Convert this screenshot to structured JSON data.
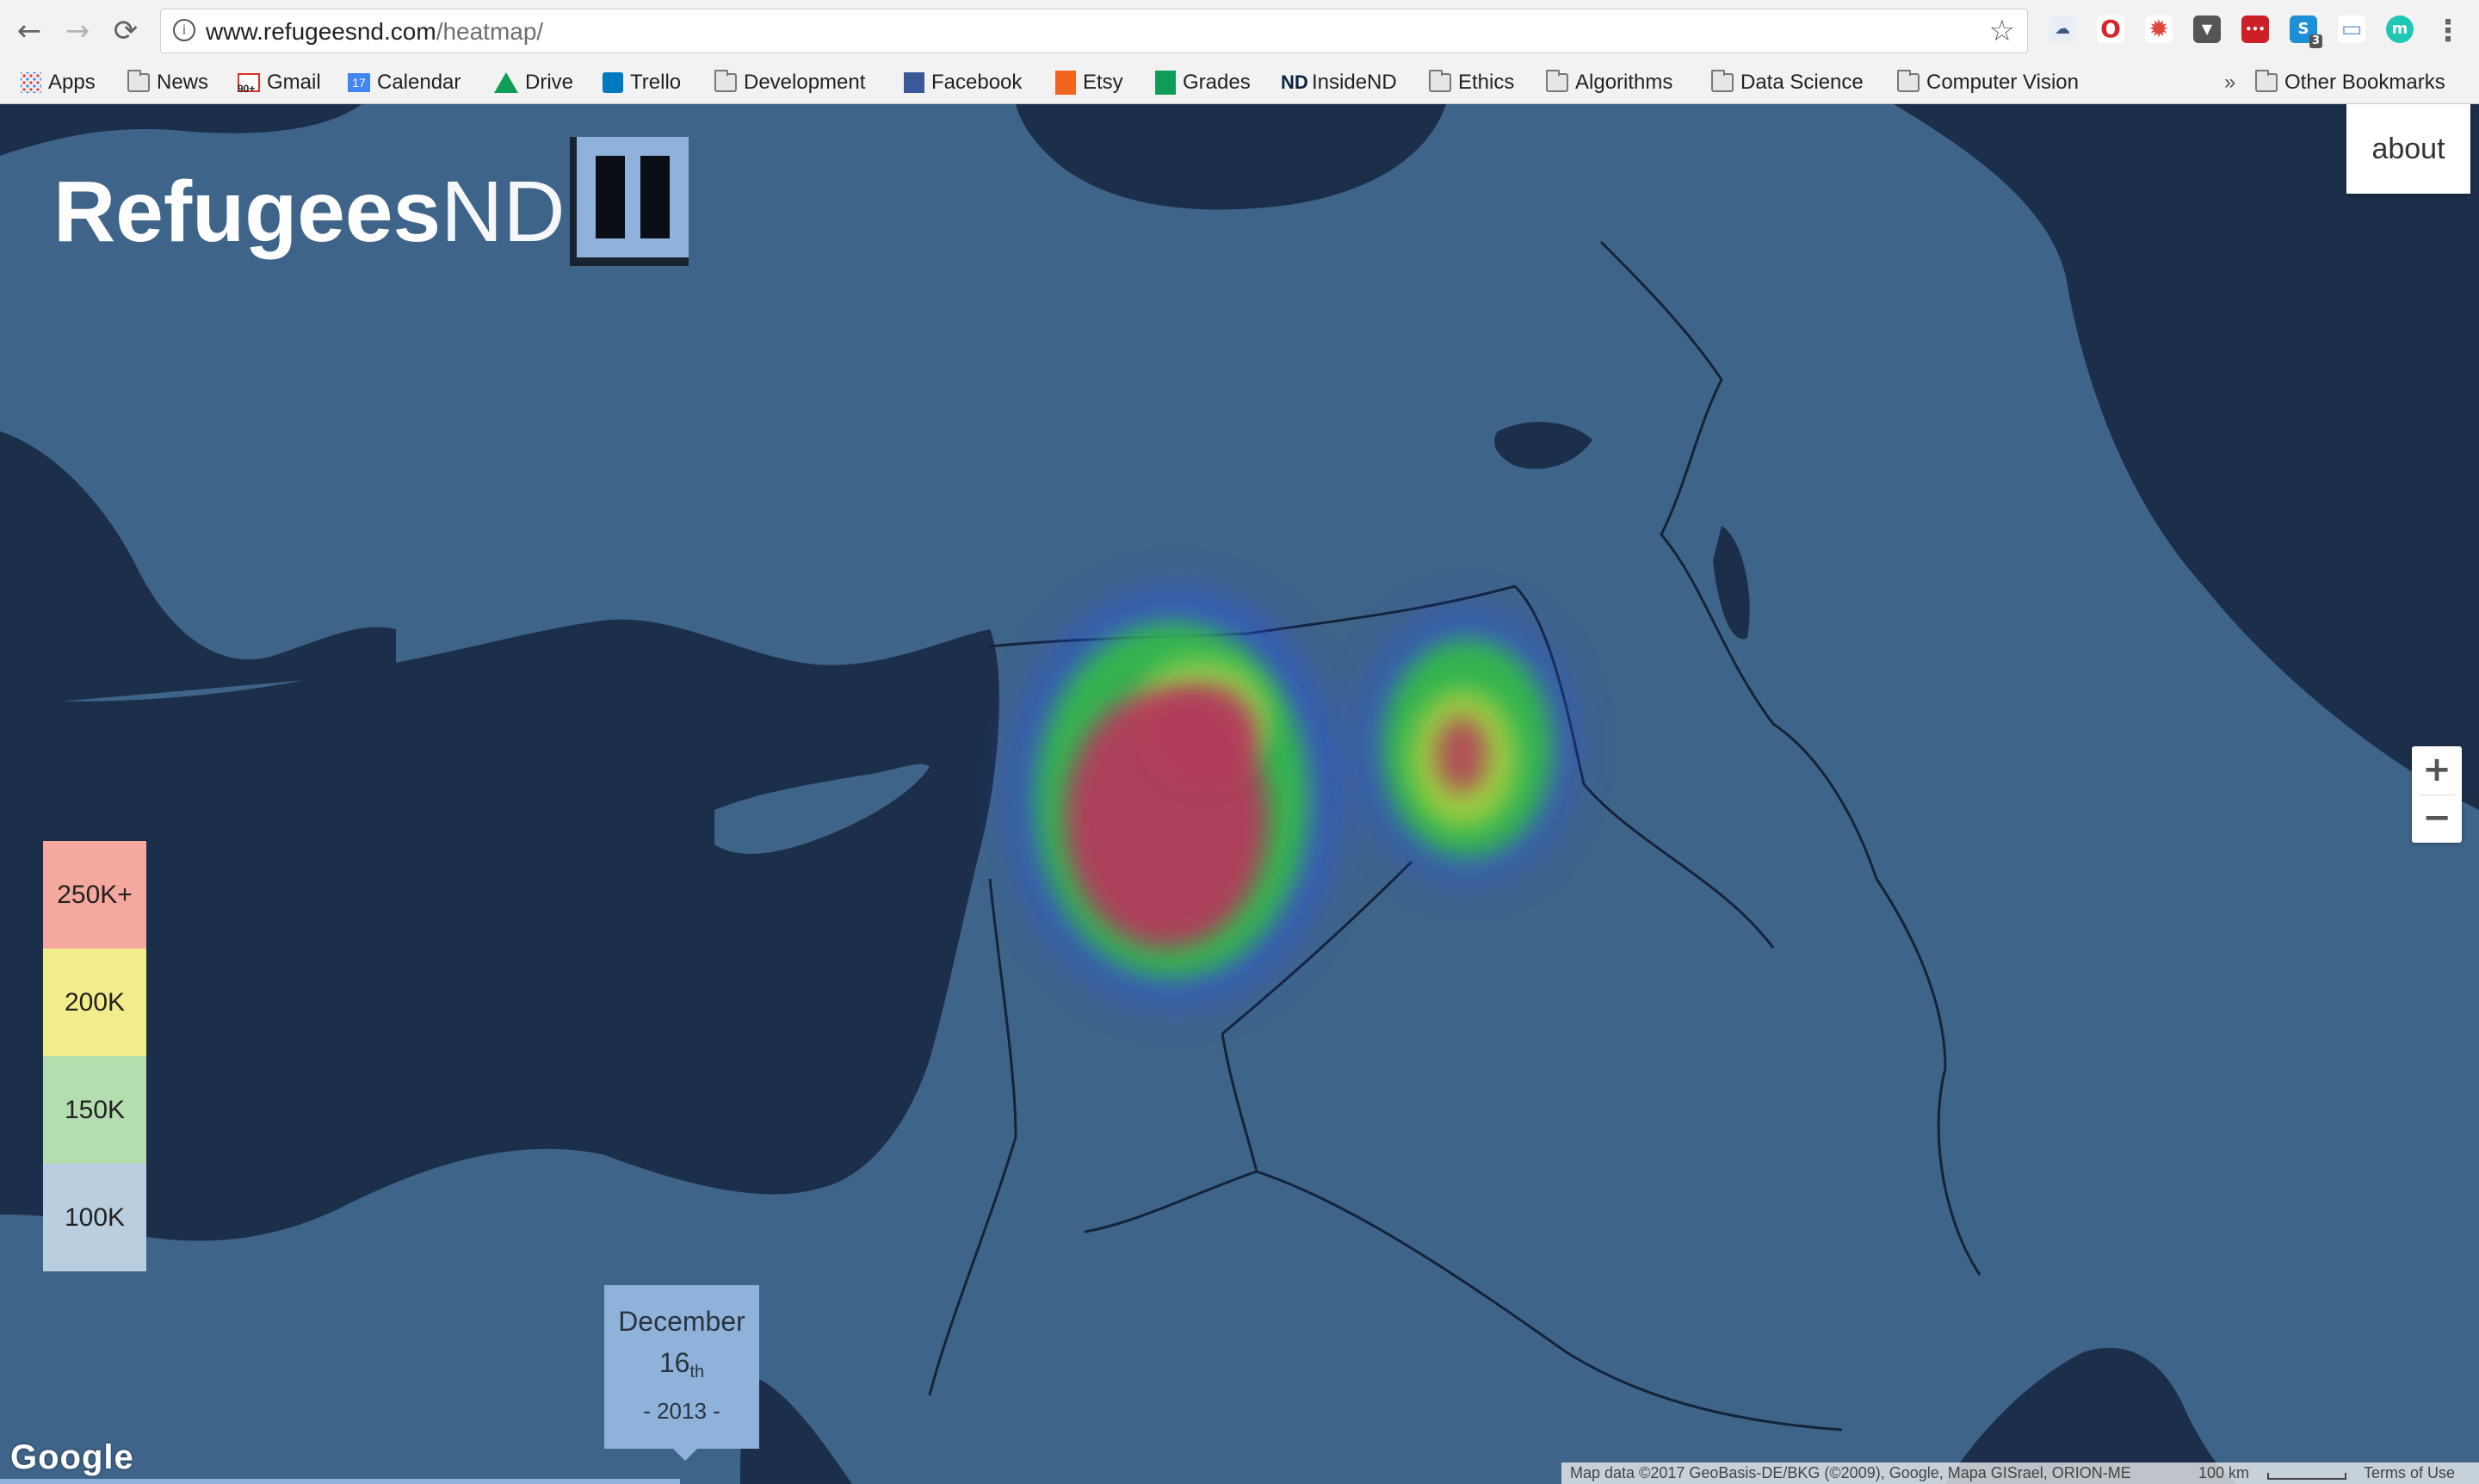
{
  "browser": {
    "url_host": "www.refugeesnd.com",
    "url_path": "/heatmap/",
    "nav": {
      "back": "←",
      "forward": "→",
      "reload": "⟳"
    },
    "star_icon": "☆",
    "menu_icon": "⋮",
    "extensions": [
      {
        "name": "cloud-extension-icon",
        "glyph": "☁",
        "color": "#3b5a86"
      },
      {
        "name": "opera-extension-icon",
        "glyph": "O",
        "color": "#d8242c"
      },
      {
        "name": "bug-extension-icon",
        "glyph": "✹",
        "color": "#e0463a"
      },
      {
        "name": "pocket-extension-icon",
        "glyph": "▼",
        "color": "#555555"
      },
      {
        "name": "lastpass-extension-icon",
        "glyph": "•••",
        "color": "#cc2027"
      },
      {
        "name": "skype-extension-icon",
        "glyph": "S",
        "color": "#1d8fd6",
        "badge": "3"
      },
      {
        "name": "window-extension-icon",
        "glyph": "▭",
        "color": "#8ab4e8"
      },
      {
        "name": "m-extension-icon",
        "glyph": "m",
        "color": "#1fc7b4"
      }
    ]
  },
  "bookmarks": {
    "items": [
      {
        "label": "Apps",
        "icon": "apps-icon"
      },
      {
        "label": "News",
        "icon": "folder-icon"
      },
      {
        "label": "Gmail",
        "icon": "gmail-icon"
      },
      {
        "label": "Calendar",
        "icon": "calendar-icon"
      },
      {
        "label": "Drive",
        "icon": "drive-icon"
      },
      {
        "label": "Trello",
        "icon": "trello-icon"
      },
      {
        "label": "Development",
        "icon": "folder-icon"
      },
      {
        "label": "Facebook",
        "icon": "facebook-icon"
      },
      {
        "label": "Etsy",
        "icon": "etsy-icon"
      },
      {
        "label": "Grades",
        "icon": "sheets-icon"
      },
      {
        "label": "InsideND",
        "icon": "nd-icon"
      },
      {
        "label": "Ethics",
        "icon": "folder-icon"
      },
      {
        "label": "Algorithms",
        "icon": "folder-icon"
      },
      {
        "label": "Data Science",
        "icon": "folder-icon"
      },
      {
        "label": "Computer Vision",
        "icon": "folder-icon"
      }
    ],
    "overflow": "»",
    "other": "Other Bookmarks",
    "gmail_badge": "90+",
    "calendar_day": "17"
  },
  "app": {
    "logo_bold": "Refugees",
    "logo_light": "ND",
    "about": "about",
    "zoom_in": "+",
    "zoom_out": "−"
  },
  "legend": [
    {
      "label": "250K+",
      "color": "#f4a89e"
    },
    {
      "label": "200K",
      "color": "#f2ec8a"
    },
    {
      "label": "150K",
      "color": "#b4ddb0"
    },
    {
      "label": "100K",
      "color": "#b9cfdf"
    }
  ],
  "date": {
    "month": "December",
    "day": "16",
    "suffix": "th",
    "year": "- 2013 -"
  },
  "map": {
    "google": "Google",
    "attribution": "Map data ©2017 GeoBasis-DE/BKG (©2009), Google, Mapa GISrael, ORION-ME",
    "scale": "100 km",
    "terms": "Terms of Use"
  }
}
